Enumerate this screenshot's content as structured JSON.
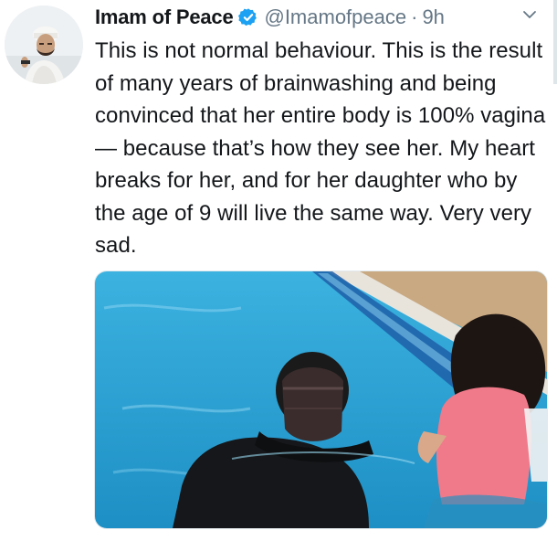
{
  "tweet": {
    "display_name": "Imam of Peace",
    "handle": "@Imamofpeace",
    "separator": "·",
    "time": "9h",
    "text": "This is not normal behaviour. This is the result of many years of brainwashing and being convinced that her entire body is 100% vagina— because that’s how they see her. My heart breaks for her, and for her daughter who by the age of 9 will live the same way. Very very sad."
  },
  "icons": {
    "avatar": "avatar-photo",
    "verified": "verified-badge-icon",
    "caret": "chevron-down-icon"
  },
  "colors": {
    "verified_blue": "#1da1f2",
    "secondary_text": "#657786",
    "primary_text": "#14171a",
    "pool_water": "#35a9d8"
  }
}
